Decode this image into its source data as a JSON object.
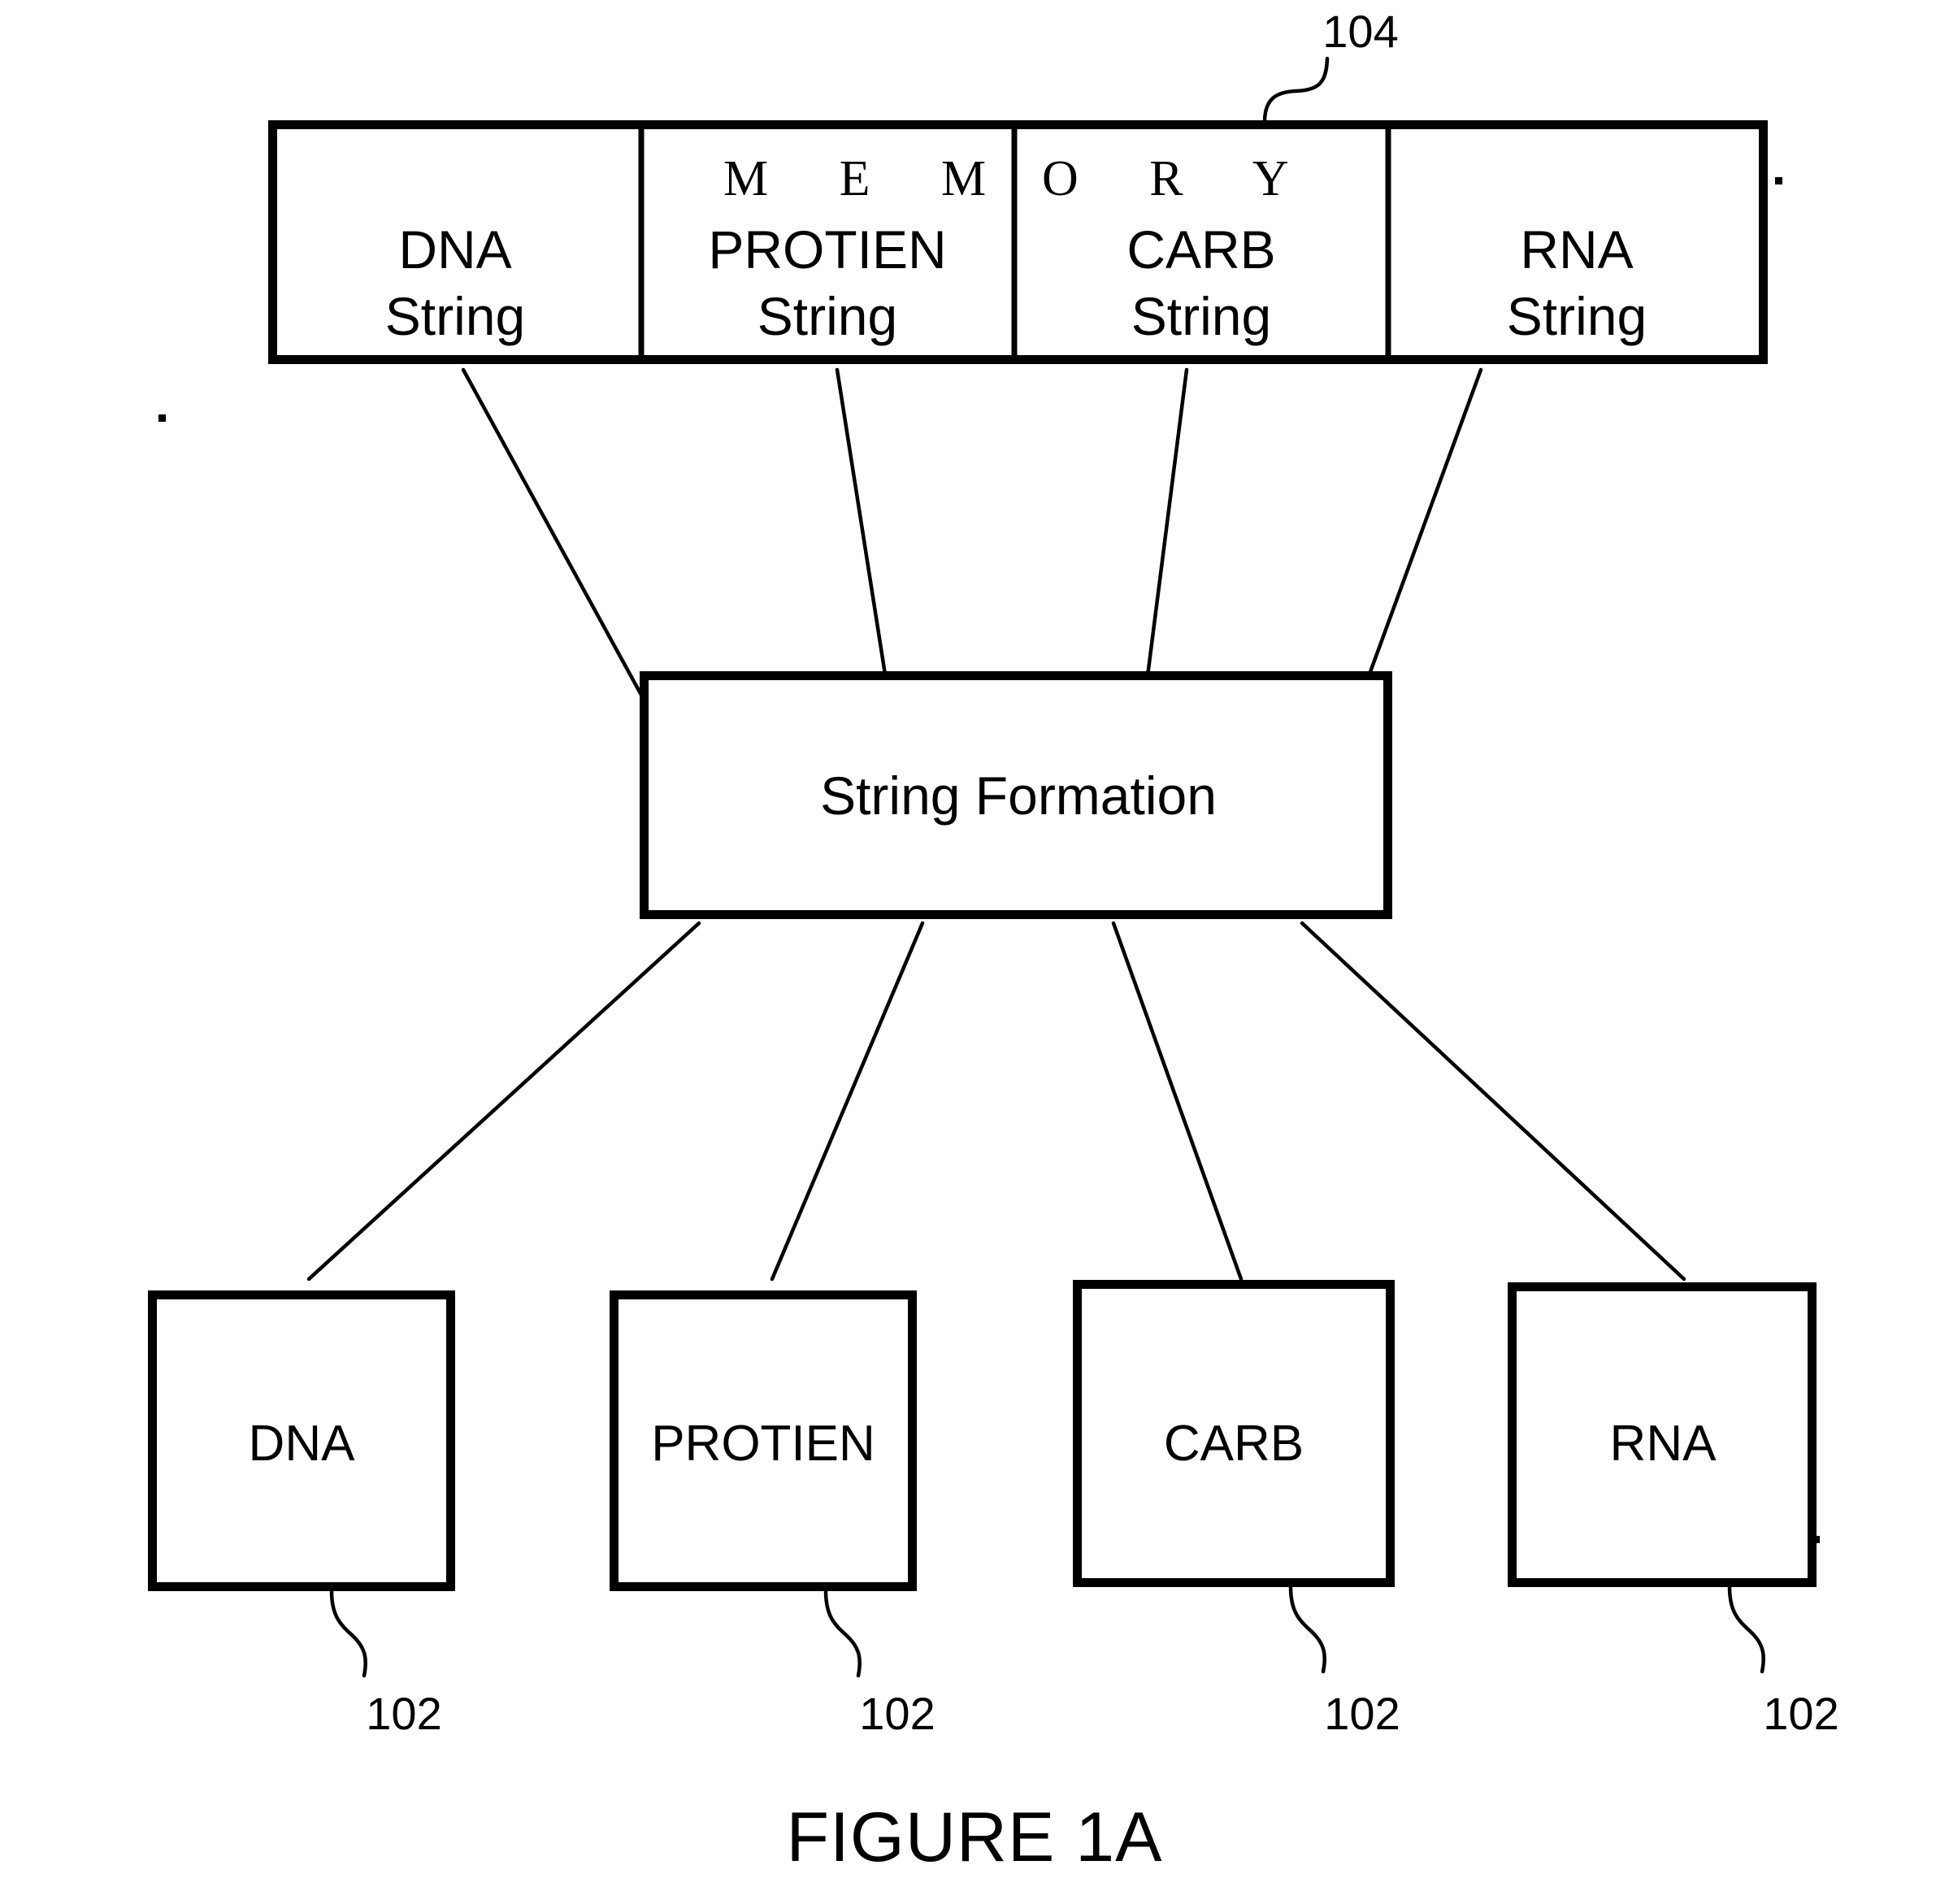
{
  "figure": {
    "caption": "FIGURE 1A"
  },
  "memory_overlay": {
    "text_left": "M E M",
    "text_right": "O R Y",
    "full_text": "MEMORY"
  },
  "top_row": {
    "reference_numeral": "104",
    "cells": [
      {
        "line1": "DNA",
        "line2": "String"
      },
      {
        "line1": "PROTIEN",
        "line2": "String"
      },
      {
        "line1": "CARB",
        "line2": "String"
      },
      {
        "line1": "RNA",
        "line2": "String"
      }
    ]
  },
  "middle_box": {
    "label": "String Formation"
  },
  "bottom_row": {
    "boxes": [
      {
        "label": "DNA",
        "reference_numeral": "102"
      },
      {
        "label": "PROTIEN",
        "reference_numeral": "102"
      },
      {
        "label": "CARB",
        "reference_numeral": "102"
      },
      {
        "label": "RNA",
        "reference_numeral": "102"
      }
    ]
  },
  "colors": {
    "ink": "#000000",
    "paper": "#ffffff"
  }
}
